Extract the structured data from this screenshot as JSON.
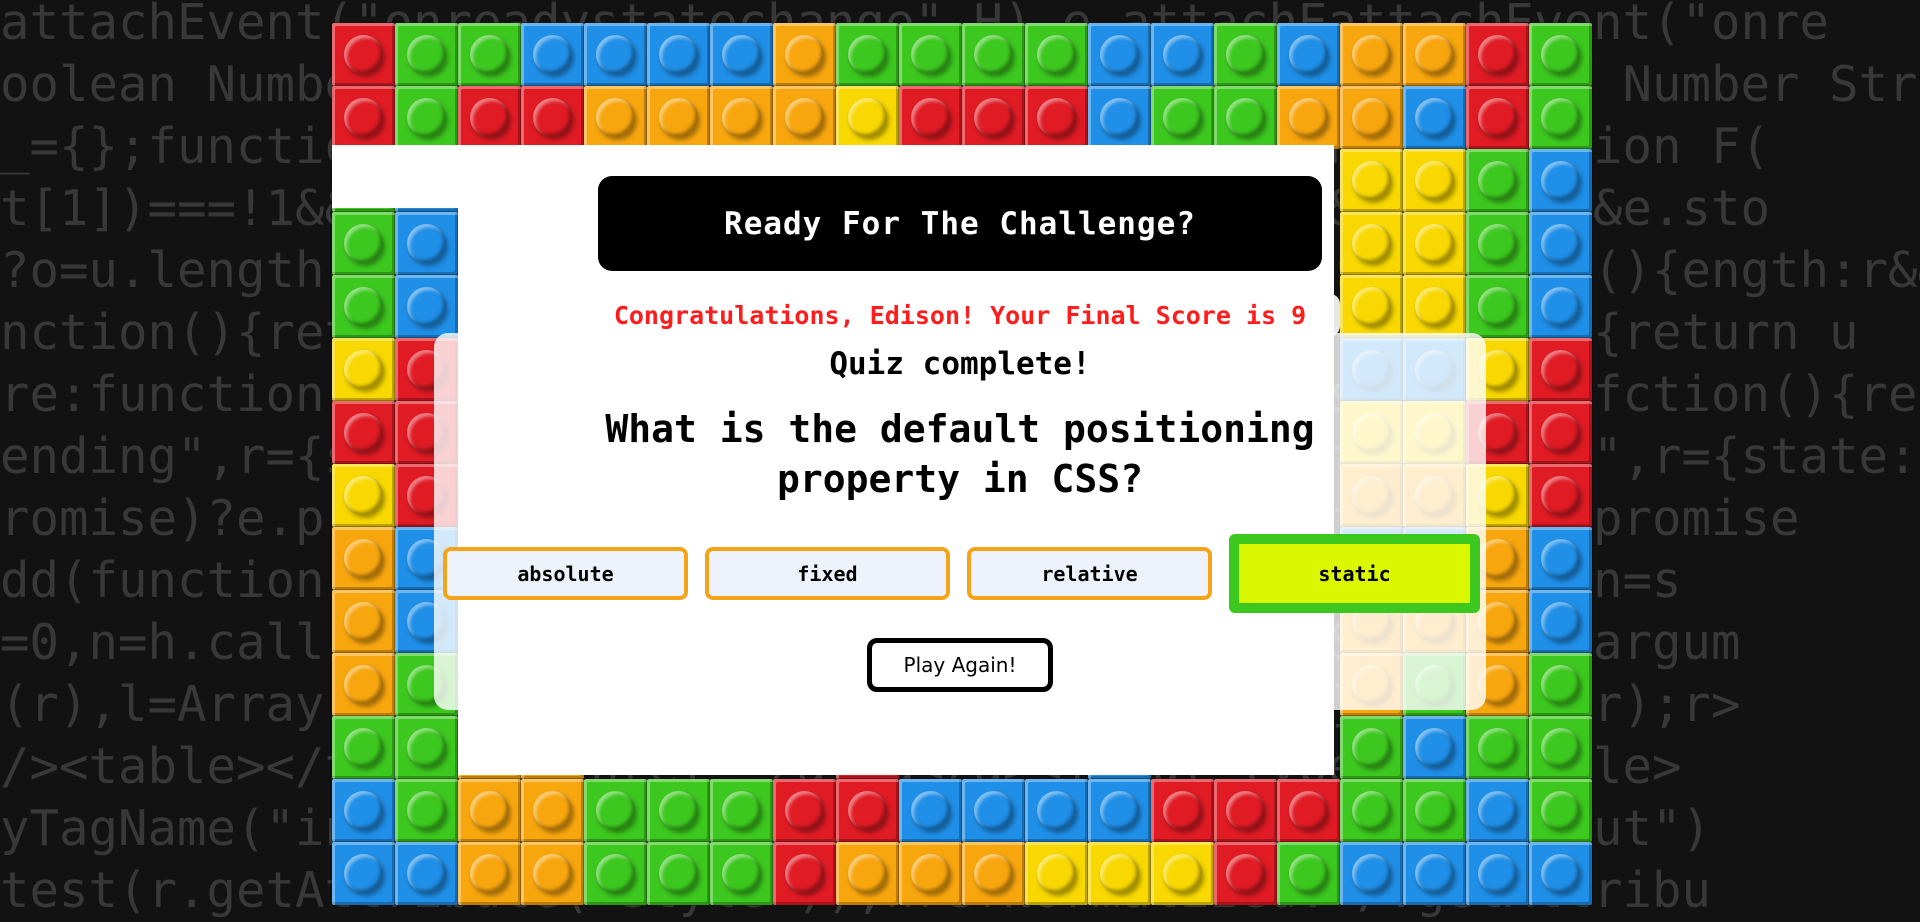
{
  "background_code": {
    "lines": [
      "attachEvent(\"onreadystatechange\",H),e.attachEattachEvent(\"onre",
      "oolean Number String Function Array Date RegExp Object Number Str",
      "_={};function F(e){var t=_[e]={};return b.each(e.function F(",
      "t[1])===!1&&e.stopOnFalse){r=!1;break}n=!1,u&&(o?==!1&&e.sto",
      "?o=u.length:r&&(s=t,c(r))}return this},remove:function(){ength:r&&(s",
      "nction(){return u=[],this},disable:function(){return(){return u",
      "re:function(){return p.fireWith(this,arguments),this},fction(){ret",
      "ending\",r={state:function(){return n},always:function(\",r={state:",
      "romise)?e.promise().done(n.resolve).fail(n.reject))?e.promise",
      "dd(function(){n=s},t[1^e][2].disable,t[2][2].lction(){n=s",
      "=0,n=h.call(arguments),r=n.length,i=1!==r||e&&b..call(argum",
      "(r),l=Array(r);r>i;i++)n[i]&&b.isFunction(n[i].pArray(r);r>",
      "/><table></table><a href='/a'>a</a><input typele></table>",
      "yTagName(\"input\")[0],r.style.cssText=\"top:1px;fme(\"input\")",
      "test(r.getAttribute(\"style\")),hrefNormalized:\"/.getAttribu"
    ]
  },
  "brick_colors": {
    "red": "#e01b24",
    "green": "#3cc81e",
    "blue": "#1f8fe8",
    "yellow": "#f8d800",
    "orange": "#f8a60e"
  },
  "header": {
    "title": "Ready For The Challenge?"
  },
  "result": {
    "congrats": "Congratulations, Edison! Your Final Score is 9",
    "status": "Quiz complete!"
  },
  "question": {
    "text": "What is the default positioning property in CSS?"
  },
  "answers": [
    {
      "label": "absolute",
      "correct": false
    },
    {
      "label": "fixed",
      "correct": false
    },
    {
      "label": "relative",
      "correct": false
    },
    {
      "label": "static",
      "correct": true
    }
  ],
  "colors": {
    "correct_fill": "#dcf800",
    "correct_border": "#3cc81e",
    "answer_border": "#f5a41a",
    "congrats_text": "#ff1c1c"
  },
  "actions": {
    "play_again": "Play Again!"
  }
}
